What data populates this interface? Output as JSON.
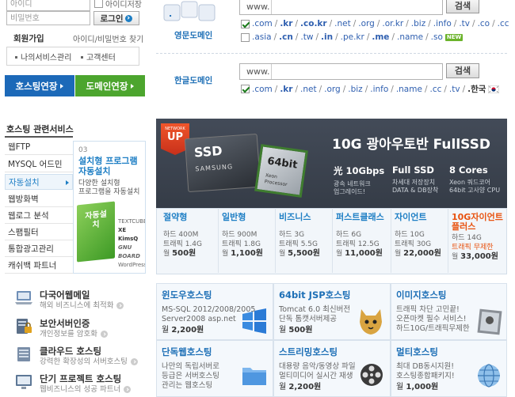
{
  "login": {
    "id_placeholder": "아이디",
    "pw_placeholder": "비밀번호",
    "save_id_label": "아이디저장",
    "login_button": "로그인",
    "join_label": "회원가입",
    "find_label": "아이디/비밀번호 찾기",
    "links": [
      "나의서비스관리",
      "고객센터"
    ]
  },
  "quick_buttons": {
    "hosting_extend": "호스팅연장",
    "domain_extend": "도메인연장"
  },
  "domain_search": {
    "english": {
      "label": "영문도메인",
      "prefix": "www.",
      "search_button": "검색",
      "row1": [
        ".com",
        ".kr",
        ".co.kr",
        ".net",
        ".org",
        ".or.kr",
        ".biz",
        ".info",
        ".tv",
        ".co",
        ".cc"
      ],
      "row2": [
        ".asia",
        ".cn",
        ".tw",
        ".in",
        ".pe.kr",
        ".me",
        ".name",
        ".so"
      ],
      "new_badge": "NEW"
    },
    "korean": {
      "label": "한글도메인",
      "prefix": "www.",
      "search_button": "검색",
      "row1": [
        ".com",
        ".kr",
        ".net",
        ".org",
        ".biz",
        ".info",
        ".name",
        ".cc",
        ".tv",
        ".한국"
      ]
    }
  },
  "hosting_menu": {
    "title": "호스팅 관련서비스",
    "items": [
      "웹FTP",
      "MYSQL 어드민",
      "자동설치",
      "웹방화벽",
      "웹로그 분석",
      "스팸필터",
      "통합광고관리",
      "캐쉬백 파트너"
    ],
    "active_index": 2
  },
  "autoinstall_promo": {
    "number": "03",
    "title_line1": "설치형 프로그램",
    "title_line2": "자동설치",
    "desc_line1": "다양한 설치형",
    "desc_line2": "프로그램을 자동설치",
    "box_text": "자동설치",
    "logos": [
      "TEXTCUBE",
      "XE",
      "KimsQ",
      "GNU BOARD",
      "WordPress"
    ]
  },
  "banner": {
    "badge_top": "NETWORK",
    "badge_main": "UP",
    "headline": "10G 광아우토반 FullSSD",
    "ssd_label": "SSD",
    "ssd_brand": "SAMSUNG",
    "cpu_label": "64bit",
    "cpu_sub": "Xeon Processor",
    "features": [
      {
        "title": "光 10Gbps",
        "line1": "광속 네트워크",
        "line2": "업그레이드!"
      },
      {
        "title": "Full SSD",
        "line1": "차세대 저장장치",
        "line2": "DATA & DB장착"
      },
      {
        "title": "8 Cores",
        "line1": "Xeon 쿼드코어",
        "line2": "64bit 고사양 CPU"
      }
    ]
  },
  "plans": [
    {
      "name": "절약형",
      "disk": "하드 400M",
      "traffic": "트래픽 1.4G",
      "price": "500원",
      "unit": "월"
    },
    {
      "name": "일반형",
      "disk": "하드 900M",
      "traffic": "트래픽 1.8G",
      "price": "1,100원",
      "unit": "월"
    },
    {
      "name": "비즈니스",
      "disk": "하드 3G",
      "traffic": "트래픽 5.5G",
      "price": "5,500원",
      "unit": "월"
    },
    {
      "name": "퍼스트클래스",
      "disk": "하드 6G",
      "traffic": "트래픽 12.5G",
      "price": "11,000원",
      "unit": "월"
    },
    {
      "name": "자이언트",
      "disk": "하드 10G",
      "traffic": "트래픽 30G",
      "price": "22,000원",
      "unit": "월"
    },
    {
      "name": "10G자이언트 플러스",
      "disk": "하드 14G",
      "traffic": "트래픽 무제한",
      "price": "33,000원",
      "unit": "월"
    }
  ],
  "services": [
    {
      "title": "다국어웹메일",
      "sub": "해외 비즈니스에 최적화"
    },
    {
      "title": "보안서버인증",
      "sub": "개인정보를 암호화"
    },
    {
      "title": "클라우드 호스팅",
      "sub": "강력한 확장성의 서버호스팅"
    },
    {
      "title": "단기 프로젝트 호스팅",
      "sub": "웹비즈니스의 성공 파트너"
    }
  ],
  "hosting_types": [
    {
      "title": "윈도우호스팅",
      "line1": "MS-SQL 2012/2008/2005",
      "line2": "Server2008 asp.net",
      "price": "2,200원",
      "unit": "월"
    },
    {
      "title": "64bit JSP호스팅",
      "line1": "Tomcat 6.0 최신버전",
      "line2": "단독 톰캣서버제공",
      "price": "500원",
      "unit": "월"
    },
    {
      "title": "이미지호스팅",
      "line1": "트래픽 차단 고민끝!",
      "line2": "오픈마켓 필수 서비스!",
      "line3": "하드10G/트래픽무제한",
      "price": "",
      "unit": ""
    },
    {
      "title": "단독웹호스팅",
      "line1": "나만의 독립서버로",
      "line2": "등급은 서버호스팅",
      "line3": "관리는 웹호스팅",
      "price": "",
      "unit": ""
    },
    {
      "title": "스트리밍호스팅",
      "line1": "대용량 음악/동영상 파일",
      "line2": "멀티미디어 실시간 재생",
      "price": "2,200원",
      "unit": "월"
    },
    {
      "title": "멀티호스팅",
      "line1": "최대 DB동시지원!",
      "line2": "호스팅종합패키지!",
      "price": "1,000원",
      "unit": "월"
    }
  ],
  "colors": {
    "accent_blue": "#1d7ec4",
    "hosting_btn": "#1c69b8",
    "domain_btn": "#4ca52e",
    "banner_bg": "#3b4350"
  }
}
